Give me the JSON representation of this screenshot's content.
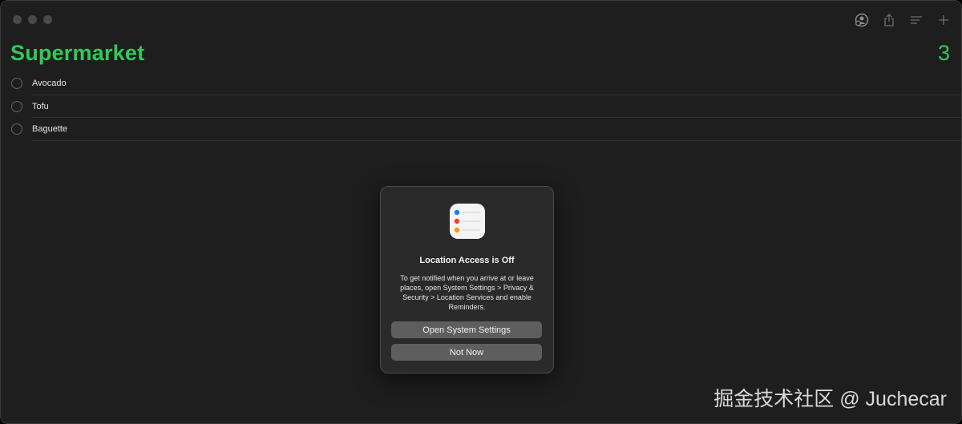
{
  "list": {
    "title": "Supermarket",
    "count": "3",
    "accent_color": "#34c759",
    "items": [
      {
        "label": "Avocado",
        "completed": false
      },
      {
        "label": "Tofu",
        "completed": false
      },
      {
        "label": "Baguette",
        "completed": false
      }
    ]
  },
  "toolbar": {
    "icons": [
      "share-people-icon",
      "share-icon",
      "view-options-icon",
      "add-icon"
    ]
  },
  "dialog": {
    "app_icon": "reminders-app-icon",
    "title": "Location Access is Off",
    "message": "To get notified when you arrive at or leave places, open System Settings > Privacy & Security > Location Services and enable Reminders.",
    "primary_button": "Open System Settings",
    "secondary_button": "Not Now"
  },
  "watermark": "掘金技术社区 @ Juchecar"
}
